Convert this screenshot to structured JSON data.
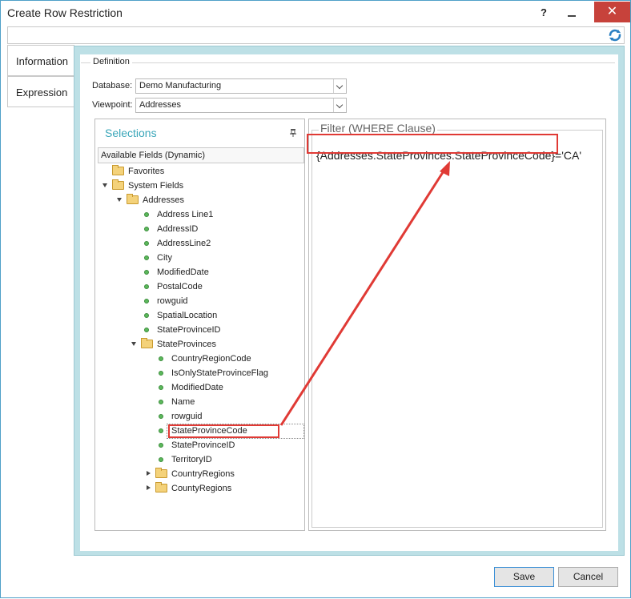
{
  "window": {
    "title": "Create Row Restriction",
    "help_label": "?",
    "close_label": "✕"
  },
  "tabs": [
    {
      "label": "Information"
    },
    {
      "label": "Expression"
    }
  ],
  "definition": {
    "legend": "Definition",
    "database_label": "Database:",
    "database_value": "Demo Manufacturing",
    "viewpoint_label": "Viewpoint:",
    "viewpoint_value": "Addresses"
  },
  "selections": {
    "title": "Selections",
    "available_label": "Available Fields (Dynamic)",
    "tree": [
      {
        "label": "Favorites"
      },
      {
        "label": "System Fields"
      },
      {
        "label": "Addresses"
      },
      {
        "label": "Address Line1"
      },
      {
        "label": "AddressID"
      },
      {
        "label": "AddressLine2"
      },
      {
        "label": "City"
      },
      {
        "label": "ModifiedDate"
      },
      {
        "label": "PostalCode"
      },
      {
        "label": "rowguid"
      },
      {
        "label": "SpatialLocation"
      },
      {
        "label": "StateProvinceID"
      },
      {
        "label": "StateProvinces"
      },
      {
        "label": "CountryRegionCode"
      },
      {
        "label": "IsOnlyStateProvinceFlag"
      },
      {
        "label": "ModifiedDate"
      },
      {
        "label": "Name"
      },
      {
        "label": "rowguid"
      },
      {
        "label": "StateProvinceCode"
      },
      {
        "label": "StateProvinceID"
      },
      {
        "label": "TerritoryID"
      },
      {
        "label": "CountryRegions"
      },
      {
        "label": "CountyRegions"
      }
    ]
  },
  "filter": {
    "legend": "Filter (WHERE Clause)",
    "expression": "{Addresses.StateProvinces.StateProvinceCode}='CA'"
  },
  "buttons": {
    "save": "Save",
    "cancel": "Cancel"
  },
  "colors": {
    "accent": "#3aa6b9",
    "highlight": "#e03a35",
    "close": "#c7423b",
    "panel_bg": "#bde0e6"
  },
  "icons": [
    "help-icon",
    "minimize-icon",
    "close-icon",
    "refresh-icon",
    "pin-icon",
    "folder-icon",
    "field-icon"
  ]
}
